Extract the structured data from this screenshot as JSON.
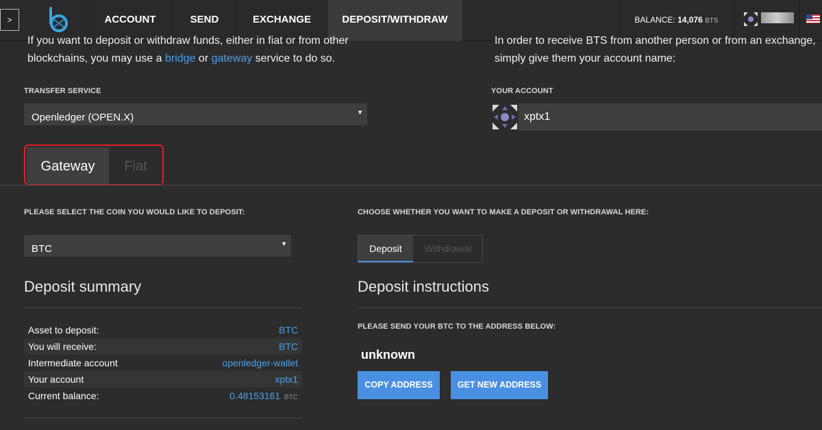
{
  "nav": {
    "menu_toggle": ">",
    "items": [
      "ACCOUNT",
      "SEND",
      "EXCHANGE",
      "DEPOSIT/WITHDRAW"
    ],
    "balance_label": "BALANCE:",
    "balance_value": "14,076",
    "balance_unit": "BTS",
    "logo_icon": "bitshares-logo-icon",
    "flag_icon": "us-flag-icon"
  },
  "intro_left": {
    "line1": "If you want to deposit or withdraw funds, either in fiat or from other",
    "line2_pre": "blockchains, you may use a ",
    "link_bridge": "bridge",
    "line2_mid": " or ",
    "link_gateway": "gateway",
    "line2_post": " service to do so."
  },
  "intro_right": {
    "line1": "In order to receive BTS from another person or from an exchange,",
    "line2": "simply give them your account name:"
  },
  "transfer_service": {
    "label": "TRANSFER SERVICE",
    "value": "Openledger (OPEN.X)"
  },
  "your_account": {
    "label": "YOUR ACCOUNT",
    "name": "xptx1"
  },
  "tabs": [
    "Gateway",
    "Fiat"
  ],
  "coin_select": {
    "label": "PLEASE SELECT THE COIN YOU WOULD LIKE TO DEPOSIT:",
    "value": "BTC"
  },
  "mode": {
    "label": "CHOOSE WHETHER YOU WANT TO MAKE A DEPOSIT OR WITHDRAWAL HERE:",
    "options": [
      "Deposit",
      "Withdrawal"
    ]
  },
  "summary": {
    "title": "Deposit summary",
    "rows": [
      {
        "key": "Asset to deposit:",
        "value": "BTC"
      },
      {
        "key": "You will receive:",
        "value": "BTC"
      },
      {
        "key": "Intermediate account",
        "value": "openledger-wallet"
      },
      {
        "key": "Your account",
        "value": "xptx1"
      },
      {
        "key": "Current balance:",
        "value": "0.48153161",
        "unit": "BTC"
      }
    ]
  },
  "instructions": {
    "title": "Deposit instructions",
    "label": "PLEASE SEND YOUR BTC TO THE ADDRESS BELOW:",
    "address": "unknown",
    "copy_button": "COPY ADDRESS",
    "new_button": "GET NEW ADDRESS"
  },
  "colors": {
    "accent": "#4a90e2",
    "link": "#4aa0e6",
    "highlight_outline": "#e01e24",
    "background": "#2c2c2c"
  }
}
